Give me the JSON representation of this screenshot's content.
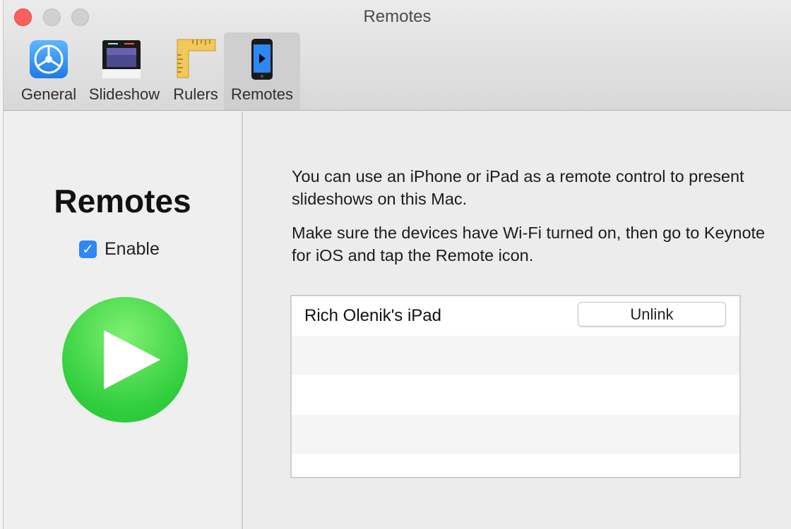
{
  "window": {
    "title": "Remotes"
  },
  "toolbar": {
    "tabs": [
      {
        "label": "General",
        "icon": "gear-icon"
      },
      {
        "label": "Slideshow",
        "icon": "slideshow-icon"
      },
      {
        "label": "Rulers",
        "icon": "ruler-icon"
      },
      {
        "label": "Remotes",
        "icon": "iphone-remote-icon",
        "selected": true
      }
    ]
  },
  "sidebar": {
    "heading": "Remotes",
    "enable_label": "Enable",
    "enable_checked": true,
    "icon": "play-icon"
  },
  "main": {
    "para1": "You can use an iPhone or iPad as a remote control to present slideshows on this Mac.",
    "para2": "Make sure the devices have Wi-Fi turned on, then go to Keynote for iOS and tap the Remote icon.",
    "devices": [
      {
        "name": "Rich Olenik's iPad",
        "action": "Unlink"
      }
    ]
  },
  "colors": {
    "accent": "#2f86f6",
    "close": "#fc605c",
    "play": "#34cf40"
  }
}
